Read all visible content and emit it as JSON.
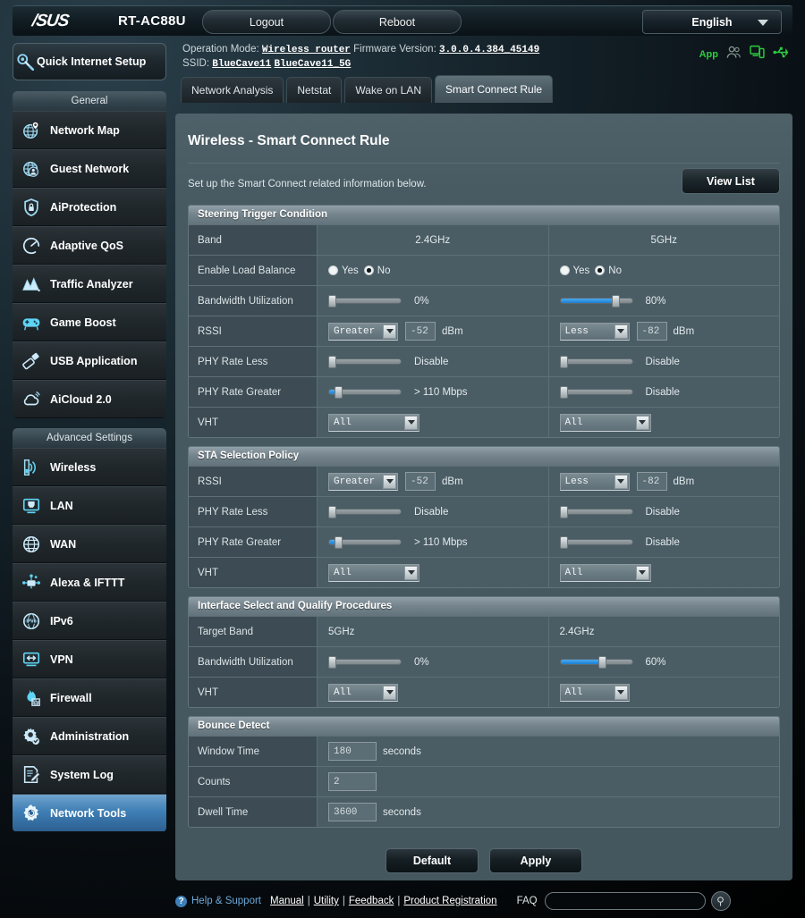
{
  "header": {
    "brand": "/SUS",
    "model": "RT-AC88U",
    "logout_label": "Logout",
    "reboot_label": "Reboot",
    "language": "English"
  },
  "sidebar": {
    "quick_setup_label": "Quick Internet Setup",
    "groups": [
      {
        "title": "General",
        "items": [
          {
            "label": "Network Map",
            "icon": "network-map-icon"
          },
          {
            "label": "Guest Network",
            "icon": "guest-network-icon"
          },
          {
            "label": "AiProtection",
            "icon": "shield-lock-icon"
          },
          {
            "label": "Adaptive QoS",
            "icon": "gauge-icon"
          },
          {
            "label": "Traffic Analyzer",
            "icon": "chart-peaks-icon"
          },
          {
            "label": "Game Boost",
            "icon": "gamepad-icon"
          },
          {
            "label": "USB Application",
            "icon": "usb-icon"
          },
          {
            "label": "AiCloud 2.0",
            "icon": "cloud-icon"
          }
        ]
      },
      {
        "title": "Advanced Settings",
        "items": [
          {
            "label": "Wireless",
            "icon": "wifi-icon"
          },
          {
            "label": "LAN",
            "icon": "ethernet-port-icon"
          },
          {
            "label": "WAN",
            "icon": "globe-icon"
          },
          {
            "label": "Alexa & IFTTT",
            "icon": "alexa-ifttt-icon"
          },
          {
            "label": "IPv6",
            "icon": "ipv6-globe-icon"
          },
          {
            "label": "VPN",
            "icon": "vpn-monitor-icon"
          },
          {
            "label": "Firewall",
            "icon": "firewall-flame-icon"
          },
          {
            "label": "Administration",
            "icon": "gear-admin-icon"
          },
          {
            "label": "System Log",
            "icon": "log-pencil-icon"
          },
          {
            "label": "Network Tools",
            "icon": "network-tools-gear-icon",
            "active": true
          }
        ]
      }
    ]
  },
  "info": {
    "operation_mode_label": "Operation Mode:",
    "operation_mode_value": "Wireless router",
    "firmware_label": "Firmware Version:",
    "firmware_value": "3.0.0.4.384_45149",
    "ssid_label": "SSID:",
    "ssid_24": "BlueCave11",
    "ssid_5g": "BlueCave11_5G",
    "app_label": "App"
  },
  "tabs": [
    {
      "label": "Network Analysis",
      "active": false
    },
    {
      "label": "Netstat",
      "active": false
    },
    {
      "label": "Wake on LAN",
      "active": false
    },
    {
      "label": "Smart Connect Rule",
      "active": true
    }
  ],
  "page": {
    "title": "Wireless - Smart Connect Rule",
    "description": "Set up the Smart Connect related information below.",
    "view_list_label": "View List"
  },
  "steering_trigger": {
    "title": "Steering Trigger Condition",
    "band_label": "Band",
    "band_24": "2.4GHz",
    "band_5g": "5GHz",
    "load_balance_label": "Enable Load Balance",
    "yes_label": "Yes",
    "no_label": "No",
    "lb_24_selected": "No",
    "lb_5g_selected": "No",
    "bandwidth_label": "Bandwidth Utilization",
    "bw_24_value": "0%",
    "bw_24_pct": 0,
    "bw_5g_value": "80%",
    "bw_5g_pct": 80,
    "rssi_label": "RSSI",
    "rssi_24_op": "Greater",
    "rssi_24_val": "-52",
    "rssi_5g_op": "Less",
    "rssi_5g_val": "-82",
    "rssi_unit": "dBm",
    "phy_less_label": "PHY Rate Less",
    "phy_less_24": "Disable",
    "phy_less_24_pct": 0,
    "phy_less_5g": "Disable",
    "phy_less_5g_pct": 0,
    "phy_greater_label": "PHY Rate Greater",
    "phy_greater_24": "> 110 Mbps",
    "phy_greater_24_pct": 9,
    "phy_greater_5g": "Disable",
    "phy_greater_5g_pct": 0,
    "vht_label": "VHT",
    "vht_24": "All",
    "vht_5g": "All"
  },
  "sta_selection": {
    "title": "STA Selection Policy",
    "rssi_label": "RSSI",
    "rssi_24_op": "Greater",
    "rssi_24_val": "-52",
    "rssi_5g_op": "Less",
    "rssi_5g_val": "-82",
    "rssi_unit": "dBm",
    "phy_less_label": "PHY Rate Less",
    "phy_less_24": "Disable",
    "phy_less_24_pct": 0,
    "phy_less_5g": "Disable",
    "phy_less_5g_pct": 0,
    "phy_greater_label": "PHY Rate Greater",
    "phy_greater_24": "> 110 Mbps",
    "phy_greater_24_pct": 9,
    "phy_greater_5g": "Disable",
    "phy_greater_5g_pct": 0,
    "vht_label": "VHT",
    "vht_24": "All",
    "vht_5g": "All"
  },
  "interface_select": {
    "title": "Interface Select and Qualify Procedures",
    "target_band_label": "Target Band",
    "target_band_left": "5GHz",
    "target_band_right": "2.4GHz",
    "bandwidth_label": "Bandwidth Utilization",
    "bw_left_value": "0%",
    "bw_left_pct": 0,
    "bw_right_value": "60%",
    "bw_right_pct": 60,
    "vht_label": "VHT",
    "vht_left": "All",
    "vht_right": "All"
  },
  "bounce_detect": {
    "title": "Bounce Detect",
    "window_time_label": "Window Time",
    "window_time_value": "180",
    "window_time_unit": "seconds",
    "counts_label": "Counts",
    "counts_value": "2",
    "dwell_time_label": "Dwell Time",
    "dwell_time_value": "3600",
    "dwell_time_unit": "seconds"
  },
  "actions": {
    "default_label": "Default",
    "apply_label": "Apply"
  },
  "footer": {
    "help_support": "Help & Support",
    "manual": "Manual",
    "utility": "Utility",
    "feedback": "Feedback",
    "product_registration": "Product Registration",
    "separator": "|",
    "faq_label": "FAQ",
    "faq_value": "",
    "faq_placeholder": ""
  },
  "colors": {
    "accent_blue": "#3f7fb5",
    "slider_blue": "#1d7fd1",
    "status_green": "#2ecc40",
    "link_blue": "#6ea8d8"
  }
}
